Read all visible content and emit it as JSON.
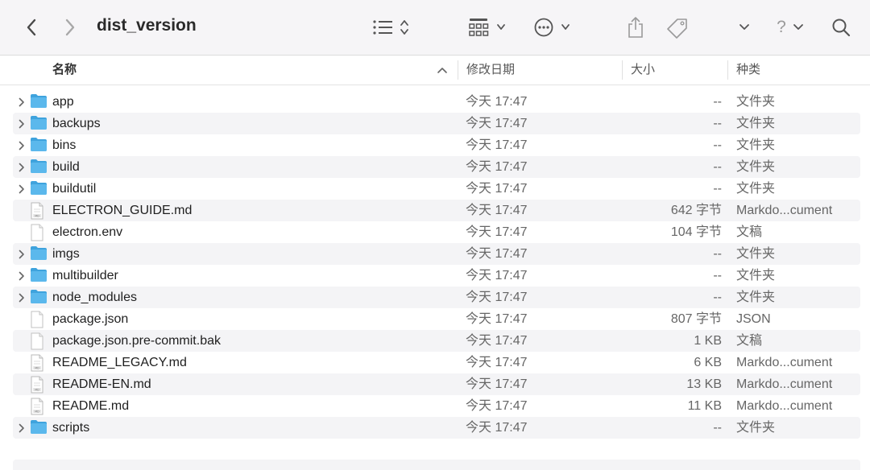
{
  "window": {
    "title": "dist_version",
    "toolbar_icons": [
      "chevron-left-icon",
      "chevron-right-icon",
      "list-view-icon",
      "grid-view-icon",
      "more-icon",
      "share-icon",
      "tag-icon",
      "chevron-down-icon",
      "help-icon",
      "search-icon"
    ],
    "help_label": "?"
  },
  "columns": {
    "name": "名称",
    "date": "修改日期",
    "size": "大小",
    "kind": "种类"
  },
  "files": [
    {
      "name": "app",
      "date": "今天 17:47",
      "size": "--",
      "kind": "文件夹",
      "type": "folder"
    },
    {
      "name": "backups",
      "date": "今天 17:47",
      "size": "--",
      "kind": "文件夹",
      "type": "folder"
    },
    {
      "name": "bins",
      "date": "今天 17:47",
      "size": "--",
      "kind": "文件夹",
      "type": "folder"
    },
    {
      "name": "build",
      "date": "今天 17:47",
      "size": "--",
      "kind": "文件夹",
      "type": "folder"
    },
    {
      "name": "buildutil",
      "date": "今天 17:47",
      "size": "--",
      "kind": "文件夹",
      "type": "folder"
    },
    {
      "name": "ELECTRON_GUIDE.md",
      "date": "今天 17:47",
      "size": "642 字节",
      "kind": "Markdo...cument",
      "type": "md"
    },
    {
      "name": "electron.env",
      "date": "今天 17:47",
      "size": "104 字节",
      "kind": "文稿",
      "type": "doc"
    },
    {
      "name": "imgs",
      "date": "今天 17:47",
      "size": "--",
      "kind": "文件夹",
      "type": "folder"
    },
    {
      "name": "multibuilder",
      "date": "今天 17:47",
      "size": "--",
      "kind": "文件夹",
      "type": "folder"
    },
    {
      "name": "node_modules",
      "date": "今天 17:47",
      "size": "--",
      "kind": "文件夹",
      "type": "folder"
    },
    {
      "name": "package.json",
      "date": "今天 17:47",
      "size": "807 字节",
      "kind": "JSON",
      "type": "doc"
    },
    {
      "name": "package.json.pre-commit.bak",
      "date": "今天 17:47",
      "size": "1 KB",
      "kind": "文稿",
      "type": "doc"
    },
    {
      "name": "README_LEGACY.md",
      "date": "今天 17:47",
      "size": "6 KB",
      "kind": "Markdo...cument",
      "type": "md"
    },
    {
      "name": "README-EN.md",
      "date": "今天 17:47",
      "size": "13 KB",
      "kind": "Markdo...cument",
      "type": "md"
    },
    {
      "name": "README.md",
      "date": "今天 17:47",
      "size": "11 KB",
      "kind": "Markdo...cument",
      "type": "md"
    },
    {
      "name": "scripts",
      "date": "今天 17:47",
      "size": "--",
      "kind": "文件夹",
      "type": "folder"
    }
  ],
  "colors": {
    "folder": "#5bb8ec",
    "folder_tab": "#3fa3dd",
    "row_alt": "#f4f4f6",
    "toolbar_bg": "#f6f5f7"
  }
}
